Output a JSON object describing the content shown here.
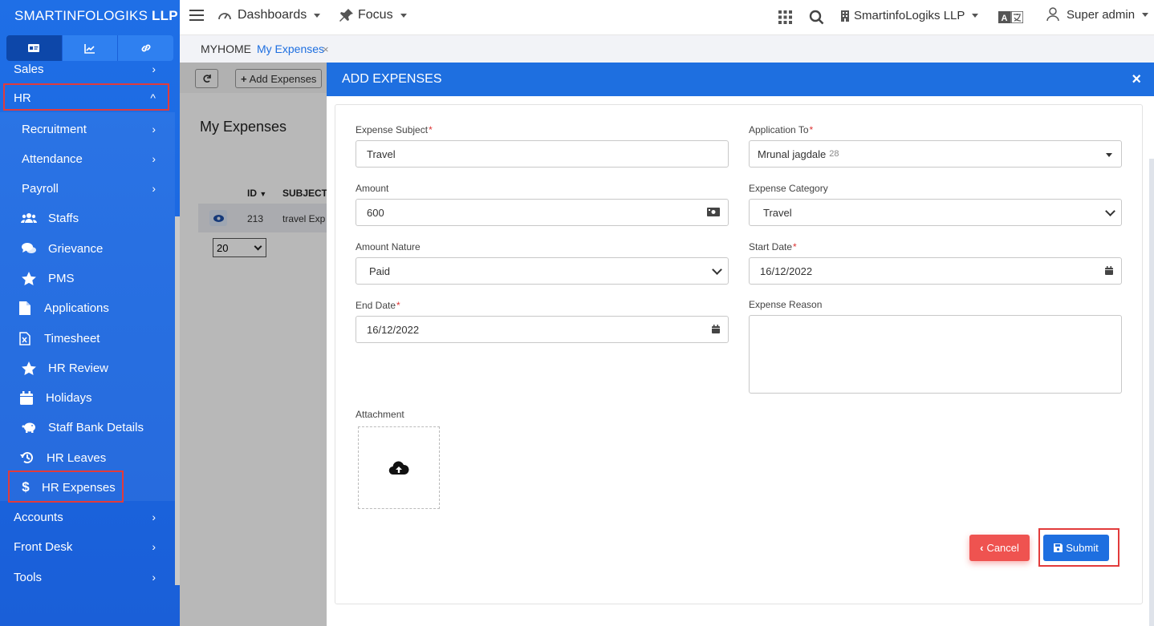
{
  "brand": {
    "light": "SMARTINFOLOGIKS",
    "bold": "LLP"
  },
  "sidebar": {
    "tabs": [
      {
        "icon": "id-card-icon",
        "active": true
      },
      {
        "icon": "chart-line-icon",
        "active": false
      },
      {
        "icon": "link-icon",
        "active": false
      }
    ],
    "items": [
      {
        "label": "Sales",
        "icon": "",
        "chevron": "›"
      },
      {
        "label": "HR",
        "icon": "",
        "chevron": "^"
      },
      {
        "label": "Recruitment",
        "icon": "",
        "chevron": "›"
      },
      {
        "label": "Attendance",
        "icon": "",
        "chevron": "›"
      },
      {
        "label": "Payroll",
        "icon": "",
        "chevron": "›"
      },
      {
        "label": "Staffs",
        "icon": "users-icon"
      },
      {
        "label": "Grievance",
        "icon": "comments-icon"
      },
      {
        "label": "PMS",
        "icon": "star-icon"
      },
      {
        "label": "Applications",
        "icon": "file-icon"
      },
      {
        "label": "Timesheet",
        "icon": "file-excel-icon"
      },
      {
        "label": "HR Review",
        "icon": "star-icon"
      },
      {
        "label": "Holidays",
        "icon": "calendar-icon"
      },
      {
        "label": "Staff Bank Details",
        "icon": "piggy-bank-icon"
      },
      {
        "label": "HR Leaves",
        "icon": "history-icon"
      },
      {
        "label": "HR Expenses",
        "icon": "dollar-icon"
      },
      {
        "label": "Accounts",
        "icon": "",
        "chevron": "›"
      },
      {
        "label": "Front Desk",
        "icon": "",
        "chevron": "›"
      },
      {
        "label": "Tools",
        "icon": "",
        "chevron": "›"
      }
    ]
  },
  "topbar": {
    "dashboards": "Dashboards",
    "focus": "Focus",
    "company": "SmartinfoLogiks LLP",
    "user": "Super admin"
  },
  "breadcrumb": {
    "home": "MYHOME",
    "current": "My Expenses",
    "close": "×"
  },
  "background": {
    "add_button": "Add Expenses",
    "title": "My Expenses",
    "columns": [
      "ID",
      "SUBJECT"
    ],
    "row": {
      "id": "213",
      "subject": "travel Exp"
    },
    "page_size": "20"
  },
  "modal": {
    "title": "ADD EXPENSES",
    "close": "×",
    "fields": {
      "expense_subject": {
        "label": "Expense Subject",
        "value": "Travel"
      },
      "application_to": {
        "label": "Application To",
        "value": "Mrunal jagdale",
        "sub": "28"
      },
      "amount": {
        "label": "Amount",
        "value": "600"
      },
      "expense_category": {
        "label": "Expense Category",
        "value": "Travel"
      },
      "amount_nature": {
        "label": "Amount Nature",
        "value": "Paid"
      },
      "start_date": {
        "label": "Start Date",
        "value": "16/12/2022"
      },
      "end_date": {
        "label": "End Date",
        "value": "16/12/2022"
      },
      "expense_reason": {
        "label": "Expense Reason",
        "value": ""
      },
      "attachment": {
        "label": "Attachment"
      }
    },
    "required_mark": "*",
    "cancel": "Cancel",
    "submit": "Submit"
  },
  "colors": {
    "primary": "#1e6fe0",
    "danger": "#ef5350",
    "highlight": "#e23b3b"
  }
}
